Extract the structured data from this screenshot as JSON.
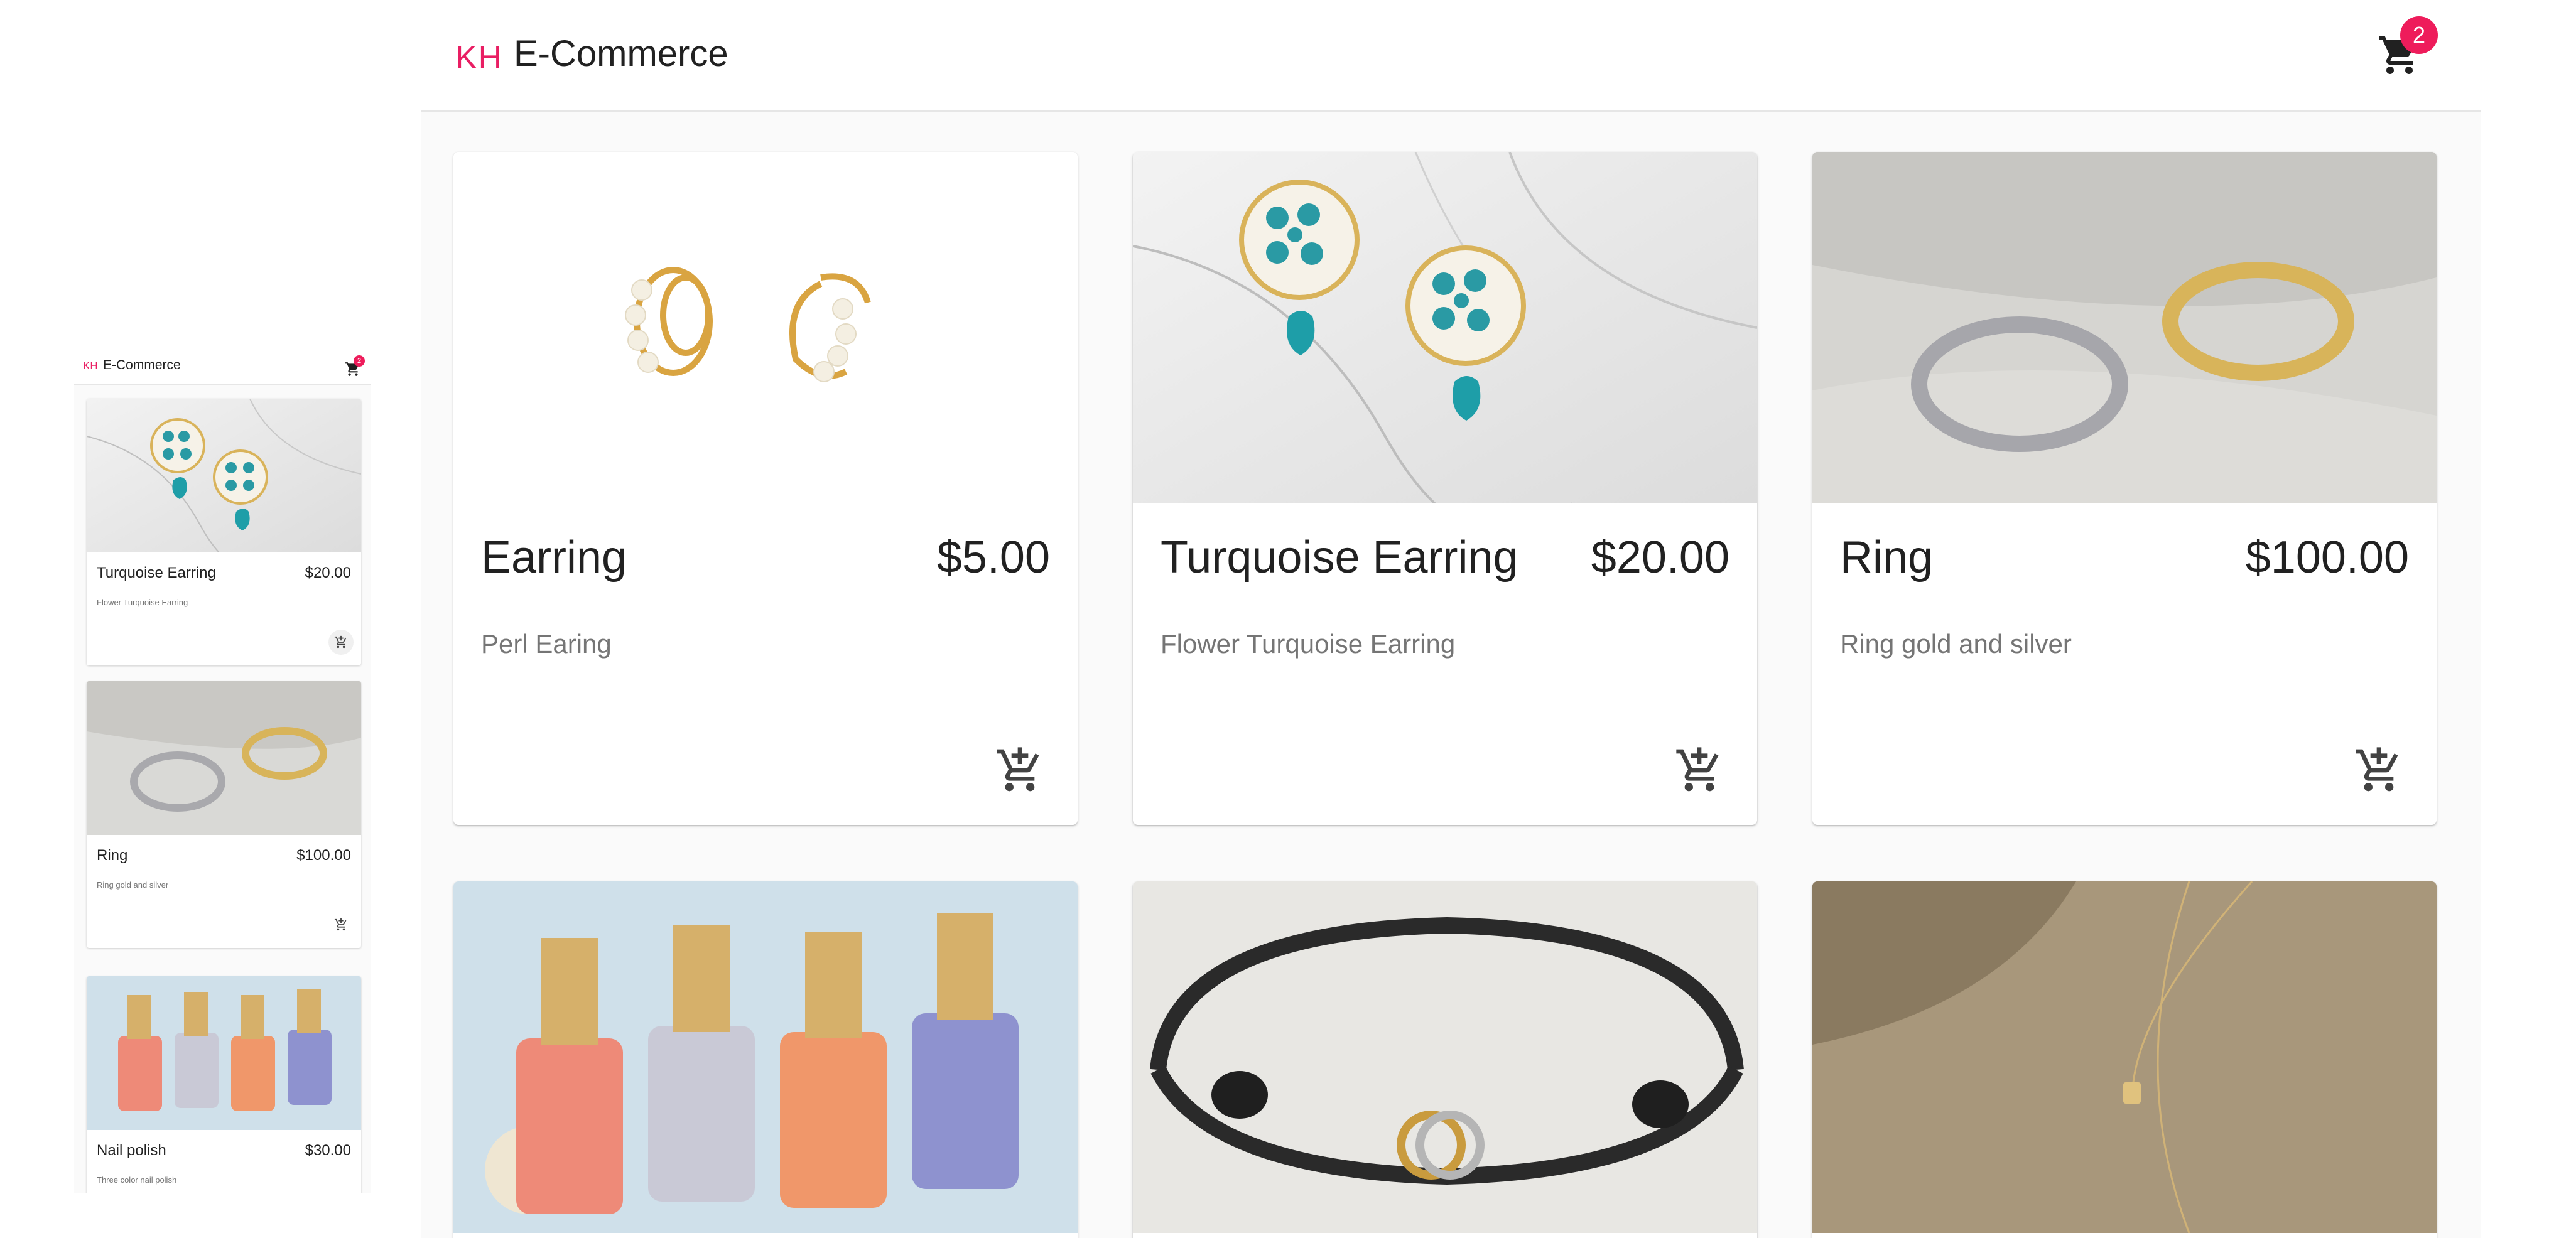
{
  "colors": {
    "brand_pink": "#e91e63",
    "badge_red": "#ee1c5b",
    "text_primary": "#212121",
    "text_secondary": "#757575"
  },
  "header": {
    "logo": "KH",
    "title": "E-Commerce",
    "cart_icon": "shopping-cart-icon",
    "cart_count": "2"
  },
  "products": [
    {
      "name": "Earring",
      "price": "$5.00",
      "description": "Perl Earing",
      "image": "pearl-earring-image"
    },
    {
      "name": "Turquoise Earring",
      "price": "$20.00",
      "description": "Flower Turquoise Earring",
      "image": "turquoise-earring-image"
    },
    {
      "name": "Ring",
      "price": "$100.00",
      "description": "Ring gold and silver",
      "image": "ring-image"
    },
    {
      "name": "",
      "price": "",
      "description": "",
      "image": "nail-polish-image"
    },
    {
      "name": "",
      "price": "",
      "description": "",
      "image": "bracelet-image"
    },
    {
      "name": "",
      "price": "",
      "description": "",
      "image": "necklace-image"
    }
  ],
  "mobile": {
    "logo": "KH",
    "title": "E-Commerce",
    "cart_count": "2",
    "products": [
      {
        "name": "Turquoise Earring",
        "price": "$20.00",
        "description": "Flower Turquoise Earring"
      },
      {
        "name": "Ring",
        "price": "$100.00",
        "description": "Ring gold and silver"
      },
      {
        "name": "Nail polish",
        "price": "$30.00",
        "description": "Three color nail polish"
      }
    ]
  }
}
